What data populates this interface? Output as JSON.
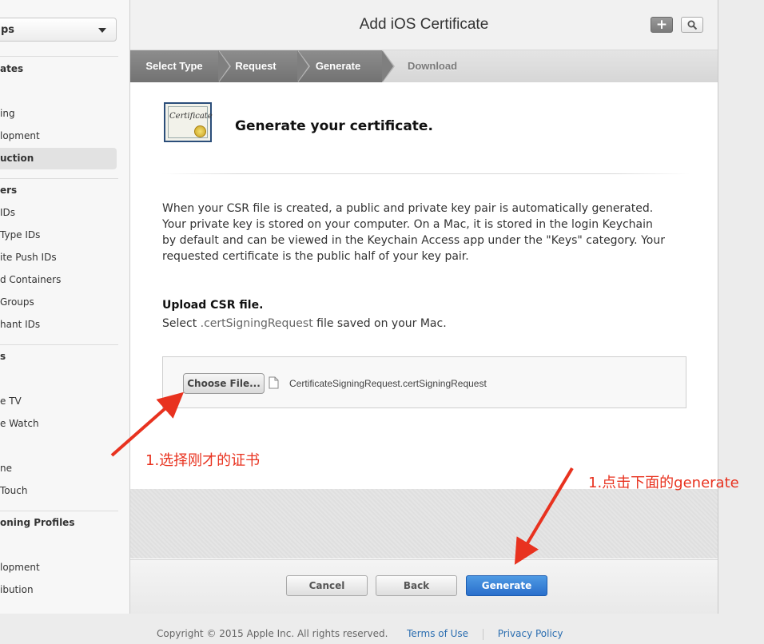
{
  "sidebar": {
    "select_value": "ps",
    "items": [
      {
        "label": "ates",
        "type": "head"
      },
      {
        "label": "ing",
        "type": "item"
      },
      {
        "label": "lopment",
        "type": "item"
      },
      {
        "label": "uction",
        "type": "active"
      },
      {
        "label": "ers",
        "type": "head"
      },
      {
        "label": "IDs",
        "type": "item"
      },
      {
        "label": "Type IDs",
        "type": "item"
      },
      {
        "label": "ite Push IDs",
        "type": "item"
      },
      {
        "label": "d Containers",
        "type": "item"
      },
      {
        "label": "Groups",
        "type": "item"
      },
      {
        "label": "hant IDs",
        "type": "item"
      },
      {
        "label": "s",
        "type": "head"
      },
      {
        "label": "e TV",
        "type": "item"
      },
      {
        "label": "e Watch",
        "type": "item"
      },
      {
        "label": "ne",
        "type": "item"
      },
      {
        "label": "Touch",
        "type": "item"
      },
      {
        "label": "oning Profiles",
        "type": "head"
      },
      {
        "label": "lopment",
        "type": "item"
      },
      {
        "label": "ibution",
        "type": "item"
      }
    ]
  },
  "header": {
    "title": "Add iOS Certificate",
    "plus_icon": "+",
    "search_icon": "search-icon"
  },
  "steps": [
    {
      "label": "Select Type",
      "state": "done"
    },
    {
      "label": "Request",
      "state": "done"
    },
    {
      "label": "Generate",
      "state": "done"
    },
    {
      "label": "Download",
      "state": "todo"
    }
  ],
  "content": {
    "cert_icon_text": "Certificate",
    "heading": "Generate your certificate.",
    "paragraph": "When your CSR file is created, a public and private key pair is automatically generated. Your private key is stored on your computer. On a Mac, it is stored in the login Keychain by default and can be viewed in the Keychain Access app under the \"Keys\" category. Your requested certificate is the public half of your key pair.",
    "upload_title": "Upload CSR file.",
    "upload_desc_prefix": "Select ",
    "upload_desc_ext": ".certSigningRequest",
    "upload_desc_suffix": " file saved on your Mac.",
    "choose_file_label": "Choose File...",
    "file_name": "CertificateSigningRequest.certSigningRequest"
  },
  "footer": {
    "cancel_label": "Cancel",
    "back_label": "Back",
    "generate_label": "Generate",
    "copyright": "Copyright © 2015 Apple Inc. All rights reserved.",
    "terms_label": "Terms of Use",
    "privacy_label": "Privacy Policy"
  },
  "annotations": {
    "choose_note": "1.选择刚才的证书",
    "generate_note": "1.点击下面的generate",
    "color": "#e8321f"
  }
}
